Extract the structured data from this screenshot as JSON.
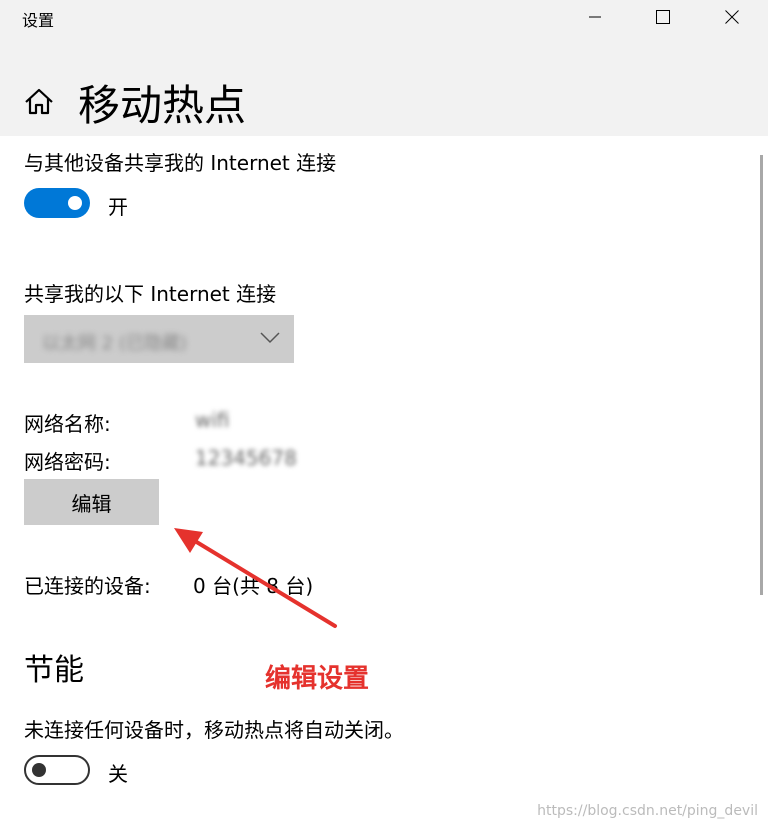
{
  "window": {
    "title": "设置"
  },
  "header": {
    "page_title": "移动热点"
  },
  "share_connection": {
    "label": "与其他设备共享我的 Internet 连接",
    "toggle_state": "on",
    "toggle_label": "开"
  },
  "share_from": {
    "label": "共享我的以下 Internet 连接",
    "selected_value": "以太网 2 (已隐藏)"
  },
  "network": {
    "name_label": "网络名称:",
    "name_value": "wifi",
    "password_label": "网络密码:",
    "password_value": "12345678",
    "edit_button_label": "编辑"
  },
  "devices": {
    "label": "已连接的设备:",
    "value": "0 台(共 8 台)"
  },
  "power_saving": {
    "heading": "节能",
    "description": "未连接任何设备时，移动热点将自动关闭。",
    "toggle_state": "off",
    "toggle_label": "关"
  },
  "annotation": {
    "label": "编辑设置",
    "color": "#e5322d"
  },
  "watermark": "https://blog.csdn.net/ping_devil",
  "colors": {
    "accent": "#0078d7",
    "titlebar_bg": "#f2f2f2",
    "control_bg": "#cccccc"
  }
}
